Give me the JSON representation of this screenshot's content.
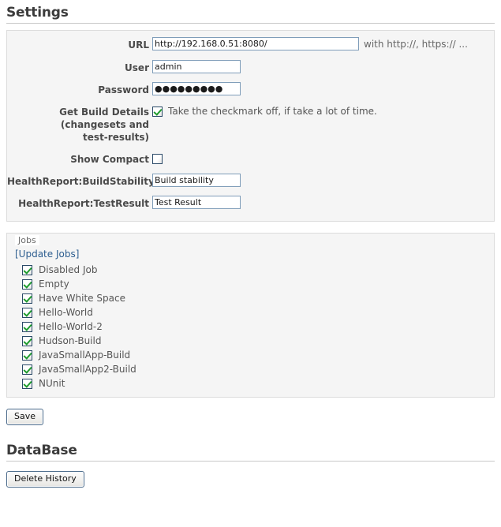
{
  "settings": {
    "heading": "Settings",
    "fields": {
      "url": {
        "label": "URL",
        "value": "http://192.168.0.51:8080/",
        "placeholder": "",
        "hint": "with http://, https:// ..."
      },
      "user": {
        "label": "User",
        "value": "admin",
        "placeholder": ""
      },
      "password": {
        "label": "Password",
        "value": "●●●●●●●●●",
        "placeholder": ""
      },
      "build_details": {
        "label_line1": "Get Build Details",
        "label_line2": "(changesets and",
        "label_line3": "test-results)",
        "checked": true,
        "description": "Take the checkmark off, if take a lot of time."
      },
      "show_compact": {
        "label": "Show Compact",
        "checked": false
      },
      "build_stability": {
        "label": "HealthReport:BuildStability",
        "value": "Build stability",
        "placeholder": ""
      },
      "test_result": {
        "label": "HealthReport:TestResult",
        "value": "Test Result",
        "placeholder": ""
      }
    }
  },
  "jobs": {
    "legend": "Jobs",
    "update_link": "[Update Jobs]",
    "items": [
      {
        "label": "Disabled Job",
        "checked": true
      },
      {
        "label": "Empty",
        "checked": true
      },
      {
        "label": "Have White Space",
        "checked": true
      },
      {
        "label": "Hello-World",
        "checked": true
      },
      {
        "label": "Hello-World-2",
        "checked": true
      },
      {
        "label": "Hudson-Build",
        "checked": true
      },
      {
        "label": "JavaSmallApp-Build",
        "checked": true
      },
      {
        "label": "JavaSmallApp2-Build",
        "checked": true
      },
      {
        "label": "NUnit",
        "checked": true
      }
    ]
  },
  "actions": {
    "save_label": "Save"
  },
  "database": {
    "heading": "DataBase",
    "delete_history_label": "Delete History"
  },
  "colors": {
    "panel_background": "#f5f5f5",
    "panel_border": "#dcdcdc",
    "input_border": "#7f9db9",
    "checkbox_border": "#2b4a68",
    "checkmark_green": "#1f9c2e",
    "link_blue": "#2c5d8f",
    "heading_text": "#3b3b3b",
    "label_text": "#4a4a4a",
    "body_text": "#555555",
    "button_border": "#4a6a8a"
  }
}
